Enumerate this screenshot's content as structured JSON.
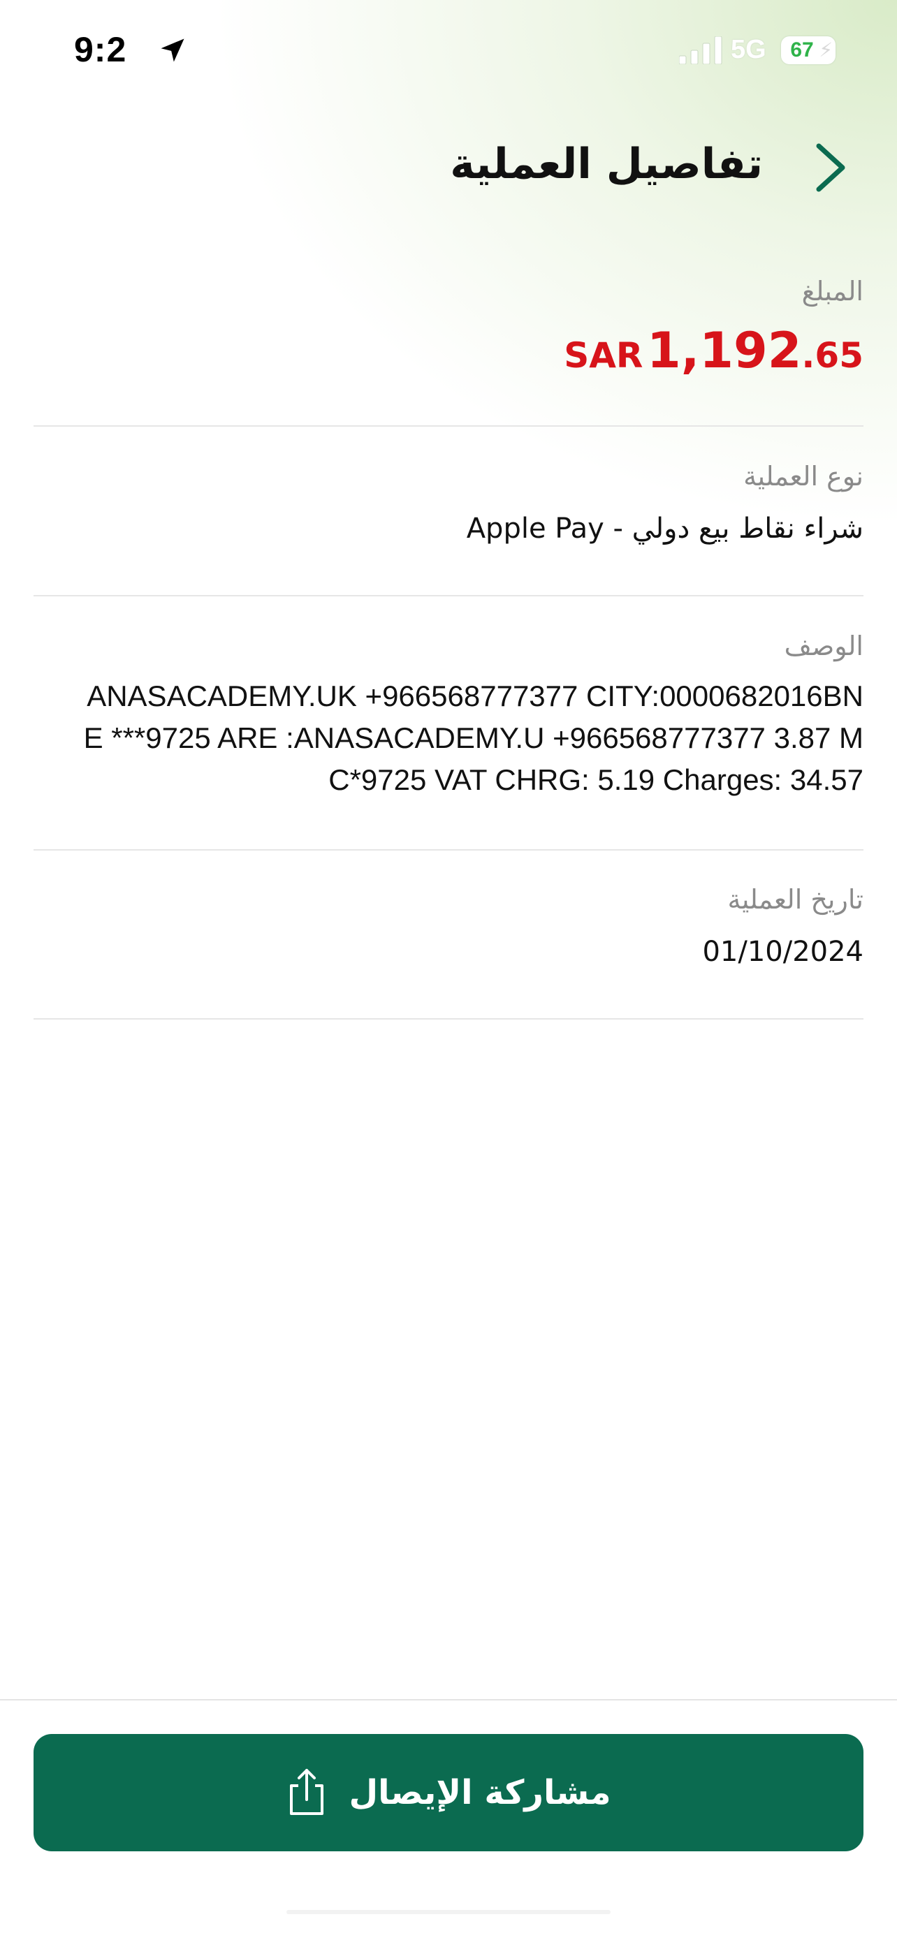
{
  "status_bar": {
    "time": "9:2",
    "network": "5G",
    "battery": "67"
  },
  "header": {
    "title": "تفاصيل العملية"
  },
  "details": {
    "amount": {
      "label": "المبلغ",
      "currency": "SAR",
      "integer": "1,192",
      "decimal": ".65",
      "color": "#d7141a"
    },
    "transaction_type": {
      "label": "نوع العملية",
      "value": "شراء نقاط بيع دولي - Apple Pay"
    },
    "description": {
      "label": "الوصف",
      "lines": [
        "ANASACADEMY.UK +966568777377 CITY:0000682016BN",
        "E ***9725 ARE :ANASACADEMY.U +966568777377 3.87 M",
        "C*9725 VAT CHRG: 5.19 Charges: 34.57"
      ]
    },
    "transaction_date": {
      "label": "تاريخ العملية",
      "value": "01/10/2024"
    }
  },
  "footer": {
    "share_label": "مشاركة الإيصال",
    "button_color": "#0b6b50"
  },
  "icons": {
    "back": "chevron-right-icon",
    "share": "share-icon",
    "location": "location-arrow-icon",
    "signal": "signal-bars-icon"
  }
}
